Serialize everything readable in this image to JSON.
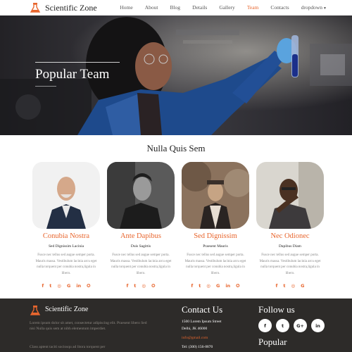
{
  "nav": {
    "brand": "Scientific Zone",
    "logo_icon": "flask-icon",
    "items": [
      {
        "label": "Home",
        "active": false
      },
      {
        "label": "About",
        "active": false
      },
      {
        "label": "Blog",
        "active": false
      },
      {
        "label": "Details",
        "active": false
      },
      {
        "label": "Gallery",
        "active": false
      },
      {
        "label": "Team",
        "active": true
      },
      {
        "label": "Contacts",
        "active": false
      },
      {
        "label": "dropdown",
        "active": false
      }
    ],
    "accent": "#e8662e"
  },
  "hero": {
    "title": "Popular Team"
  },
  "team": {
    "title": "Nulla Quis Sem",
    "members": [
      {
        "name": "Conubia Nostra",
        "role": "Sed Dignissim Lacinia",
        "desc": "Fusce nec tellus sed augue semper porta. Mauris massa. Vestibulum lacinia arcu eget nulla torquent per conubia nostra,ligula in libero."
      },
      {
        "name": "Ante Dapibus",
        "role": "Duis Sagittis",
        "desc": "Fusce nec tellus sed augue semper porta. Mauris massa. Vestibulum lacinia arcu eget nulla torquent per conubia nostra,ligula in libero."
      },
      {
        "name": "Sed Dignissim",
        "role": "Praesent Mauris",
        "desc": "Fusce nec tellus sed augue semper porta. Mauris massa. Vestibulum lacinia arcu eget nulla torquent per conubia nostra,ligula in libero."
      },
      {
        "name": "Nec Odionec",
        "role": "Dapibus Diam",
        "desc": "Fusce nec tellus sed augue semper porta. Mauris massa. Vestibulum lacinia arcu eget nulla torquent per conubia nostra,ligula in libero."
      }
    ],
    "social_icons": [
      "facebook-icon",
      "twitter-icon",
      "instagram-icon",
      "google-icon",
      "linkedin-icon",
      "vk-icon"
    ]
  },
  "footer": {
    "brand": "Scientific Zone",
    "about_text": "Lorem ipsum dolor sit amet, consectetur adipiscing elit. Praesent libero Sed nisi Nulla quis sem at nibh elementum imperdiet.",
    "about_text2": "Class aptent taciti sociosqu ad litora torquent per",
    "contact_title": "Contact Us",
    "address1": "1500 Lorem Ipsum Street",
    "address2": "Delhi, JK 46000",
    "email": "info@gmail.com",
    "phone": "Tel: (300) 156-8870",
    "follow_title": "Follow us",
    "follow_icons": [
      "facebook-icon",
      "twitter-icon",
      "google-plus-icon",
      "linkedin-icon"
    ],
    "popular_title": "Popular"
  }
}
